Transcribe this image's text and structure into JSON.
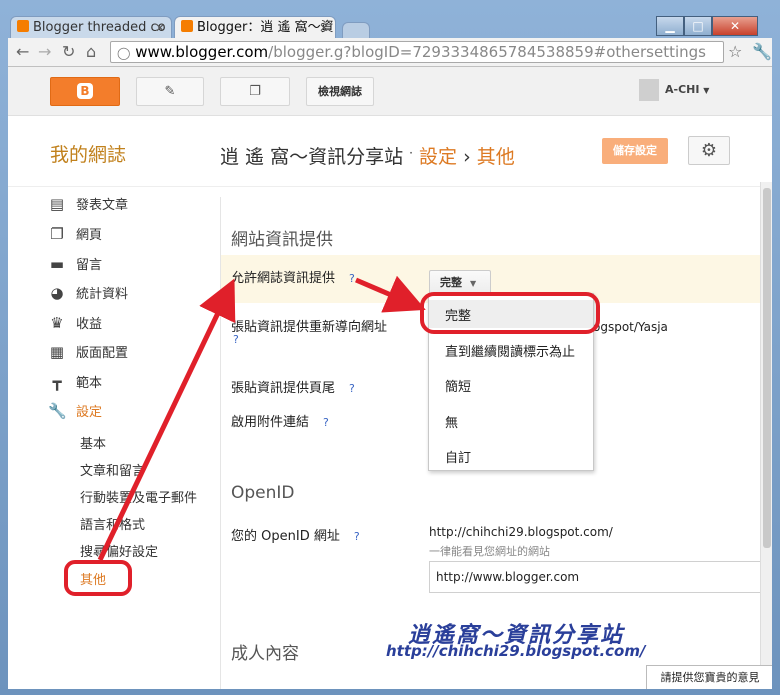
{
  "browser": {
    "tabs": [
      {
        "label": "Blogger threaded co"
      },
      {
        "label": "Blogger：逍 遙 窩～資"
      }
    ],
    "url_host": "www.blogger.com",
    "url_rest": "/blogger.g?blogID=7293334865784538859#othersettings"
  },
  "appbar": {
    "view_blog": "檢視網誌",
    "user": "A-CHI"
  },
  "header": {
    "my_blog": "我的網誌",
    "blog_name": "逍 遙 窩～資訊分享站",
    "sep": "·",
    "crumb_settings": "設定",
    "crumb_arrow": "›",
    "crumb_other": "其他",
    "save_label": "儲存設定"
  },
  "sidebar": {
    "items": [
      {
        "label": "發表文章",
        "icon": "posts-icon"
      },
      {
        "label": "網頁",
        "icon": "pages-icon"
      },
      {
        "label": "留言",
        "icon": "comments-icon"
      },
      {
        "label": "統計資料",
        "icon": "stats-icon"
      },
      {
        "label": "收益",
        "icon": "earnings-icon"
      },
      {
        "label": "版面配置",
        "icon": "layout-icon"
      },
      {
        "label": "範本",
        "icon": "template-icon"
      },
      {
        "label": "設定",
        "icon": "wrench-icon"
      }
    ],
    "sub": [
      "基本",
      "文章和留言",
      "行動裝置及電子郵件",
      "語言和格式",
      "搜尋偏好設定",
      "其他"
    ]
  },
  "main": {
    "section_feed": "網站資訊提供",
    "allow_feed": "允許網誌資訊提供",
    "help": "?",
    "dropdown_value": "完整",
    "redirect_label": "張貼資訊提供重新導向網址",
    "redirect_value": "ogspot/Yasja",
    "footer_label": "張貼資訊提供頁尾",
    "enclosure_label": "啟用附件連結",
    "section_openid": "OpenID",
    "openid_label": "您的 OpenID 網址",
    "openid_url": "http://chihchi29.blogspot.com/",
    "openid_hint": "一律能看見您網址的網站",
    "openid_input": "http://www.blogger.com",
    "section_adult": "成人內容"
  },
  "dropdown_menu": [
    "完整",
    "直到繼續閱讀標示為止",
    "簡短",
    "無",
    "自訂"
  ],
  "watermark": {
    "title": "逍遙窩～資訊分享站",
    "url": "http://chihchi29.blogspot.com/"
  },
  "feedback": "請提供您寶貴的意見",
  "colors": {
    "accent": "#dd7a23",
    "annotation": "#e0202a"
  }
}
